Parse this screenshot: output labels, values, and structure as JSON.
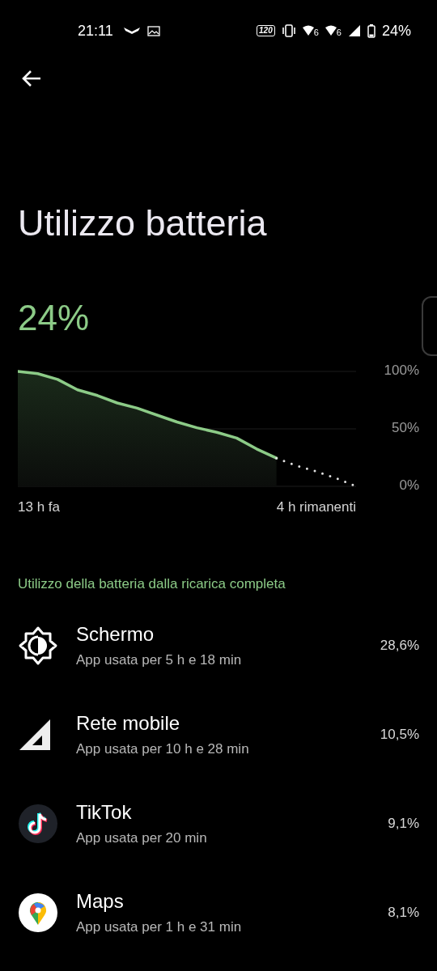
{
  "status_bar": {
    "time": "21:11",
    "refresh_badge": "120",
    "battery_text": "24%",
    "network_badges": [
      "6",
      "6"
    ]
  },
  "title": "Utilizzo batteria",
  "battery_level_text": "24%",
  "chart": {
    "start_label": "13 h fa",
    "end_label": "4 h rimanenti",
    "chart_data": {
      "type": "area",
      "categories": [
        null,
        null,
        null,
        null,
        null,
        null,
        null,
        null,
        null,
        null,
        null,
        null,
        null,
        null,
        null,
        null,
        null,
        null
      ],
      "ylim": [
        0,
        100
      ],
      "yticks": [
        {
          "value": 100,
          "label": "100%"
        },
        {
          "value": 50,
          "label": "50%"
        },
        {
          "value": 0,
          "label": "0%"
        }
      ],
      "series": [
        {
          "color": "#8ccb87",
          "line_style": "solid",
          "values": [
            100,
            98,
            93,
            84,
            79,
            72.5,
            68,
            62,
            56,
            51,
            47,
            42,
            32.5,
            24.5,
            null,
            null,
            null,
            null
          ]
        },
        {
          "type": "line",
          "color": "#e0e0e0",
          "line_style": "dotted",
          "values": [
            null,
            null,
            null,
            null,
            null,
            null,
            null,
            null,
            null,
            null,
            null,
            null,
            null,
            24.5,
            18,
            13,
            7,
            0
          ]
        }
      ]
    }
  },
  "section_title": "Utilizzo della batteria dalla ricarica completa",
  "apps": [
    {
      "kind": "screen",
      "name": "Schermo",
      "detail": "App usata per 5 h e 18 min",
      "share": "28,6%"
    },
    {
      "kind": "network",
      "name": "Rete mobile",
      "detail": "App usata per 10 h e 28 min",
      "share": "10,5%"
    },
    {
      "kind": "tiktok",
      "name": "TikTok",
      "detail": "App usata per 20 min",
      "share": "9,1%"
    },
    {
      "kind": "maps",
      "name": "Maps",
      "detail": "App usata per 1 h e 31 min",
      "share": "8,1%"
    }
  ]
}
